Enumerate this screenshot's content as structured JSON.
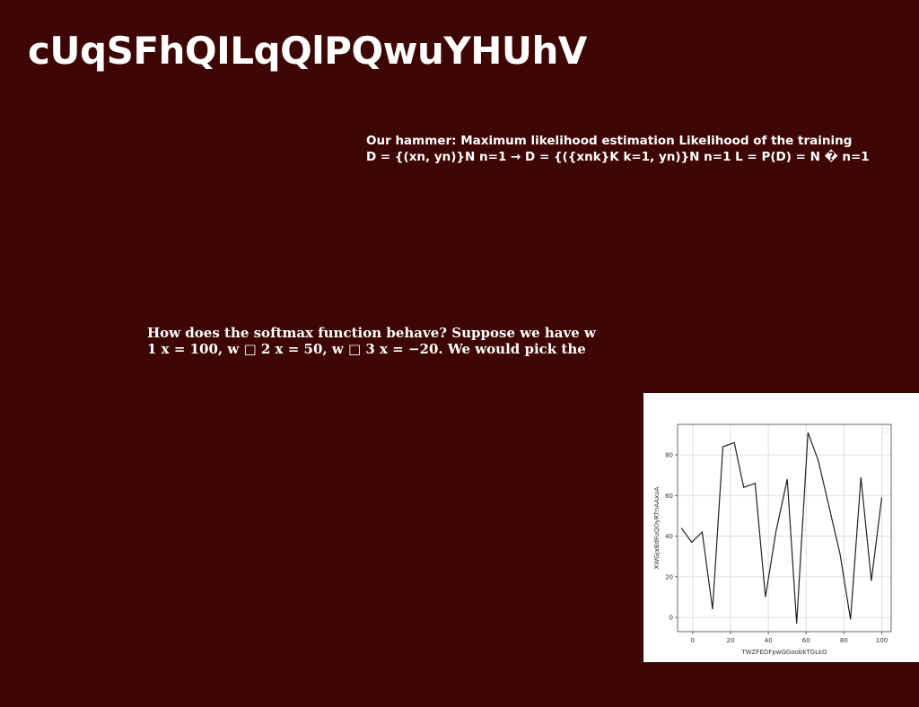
{
  "slide": {
    "title": "cUqSFhQILqQlPQwuYHUhV",
    "block1": {
      "lines": [
        "Our hammer: Maximum likelihood estimation Likelihood of the training",
        "D = {(xn, yn)}N n=1 → D = {({xnk}K k=1, yn)}N n=1 L = P(D) = N � n=1"
      ]
    },
    "block2": {
      "lines": [
        "How does the softmax function behave? Suppose we have w",
        "1 x = 100, w □ 2 x = 50, w □ 3 x = −20. We would pick the"
      ]
    }
  },
  "chart_data": {
    "type": "line",
    "xlabel": "TWZFEDFpwGGoobkTGLkO",
    "ylabel": "XWGjxBdFuQOyRTnAAxuA",
    "xlim": [
      -8,
      105
    ],
    "ylim": [
      -7,
      95
    ],
    "xticks": [
      0,
      20,
      40,
      60,
      80,
      100
    ],
    "yticks": [
      0,
      20,
      40,
      60,
      80
    ],
    "grid": true,
    "line_color": "#222222",
    "series": [
      {
        "x": [
          -6,
          -0.5,
          5,
          10.5,
          16,
          22,
          27,
          33,
          38.5,
          44,
          50,
          55,
          61,
          66.5,
          72,
          78,
          83.5,
          89,
          94.5,
          100
        ],
        "y": [
          44,
          37,
          42,
          4,
          84,
          86,
          64,
          66,
          10,
          42,
          68,
          -3,
          91,
          77,
          55,
          31,
          -1,
          69,
          18,
          59
        ]
      }
    ]
  }
}
